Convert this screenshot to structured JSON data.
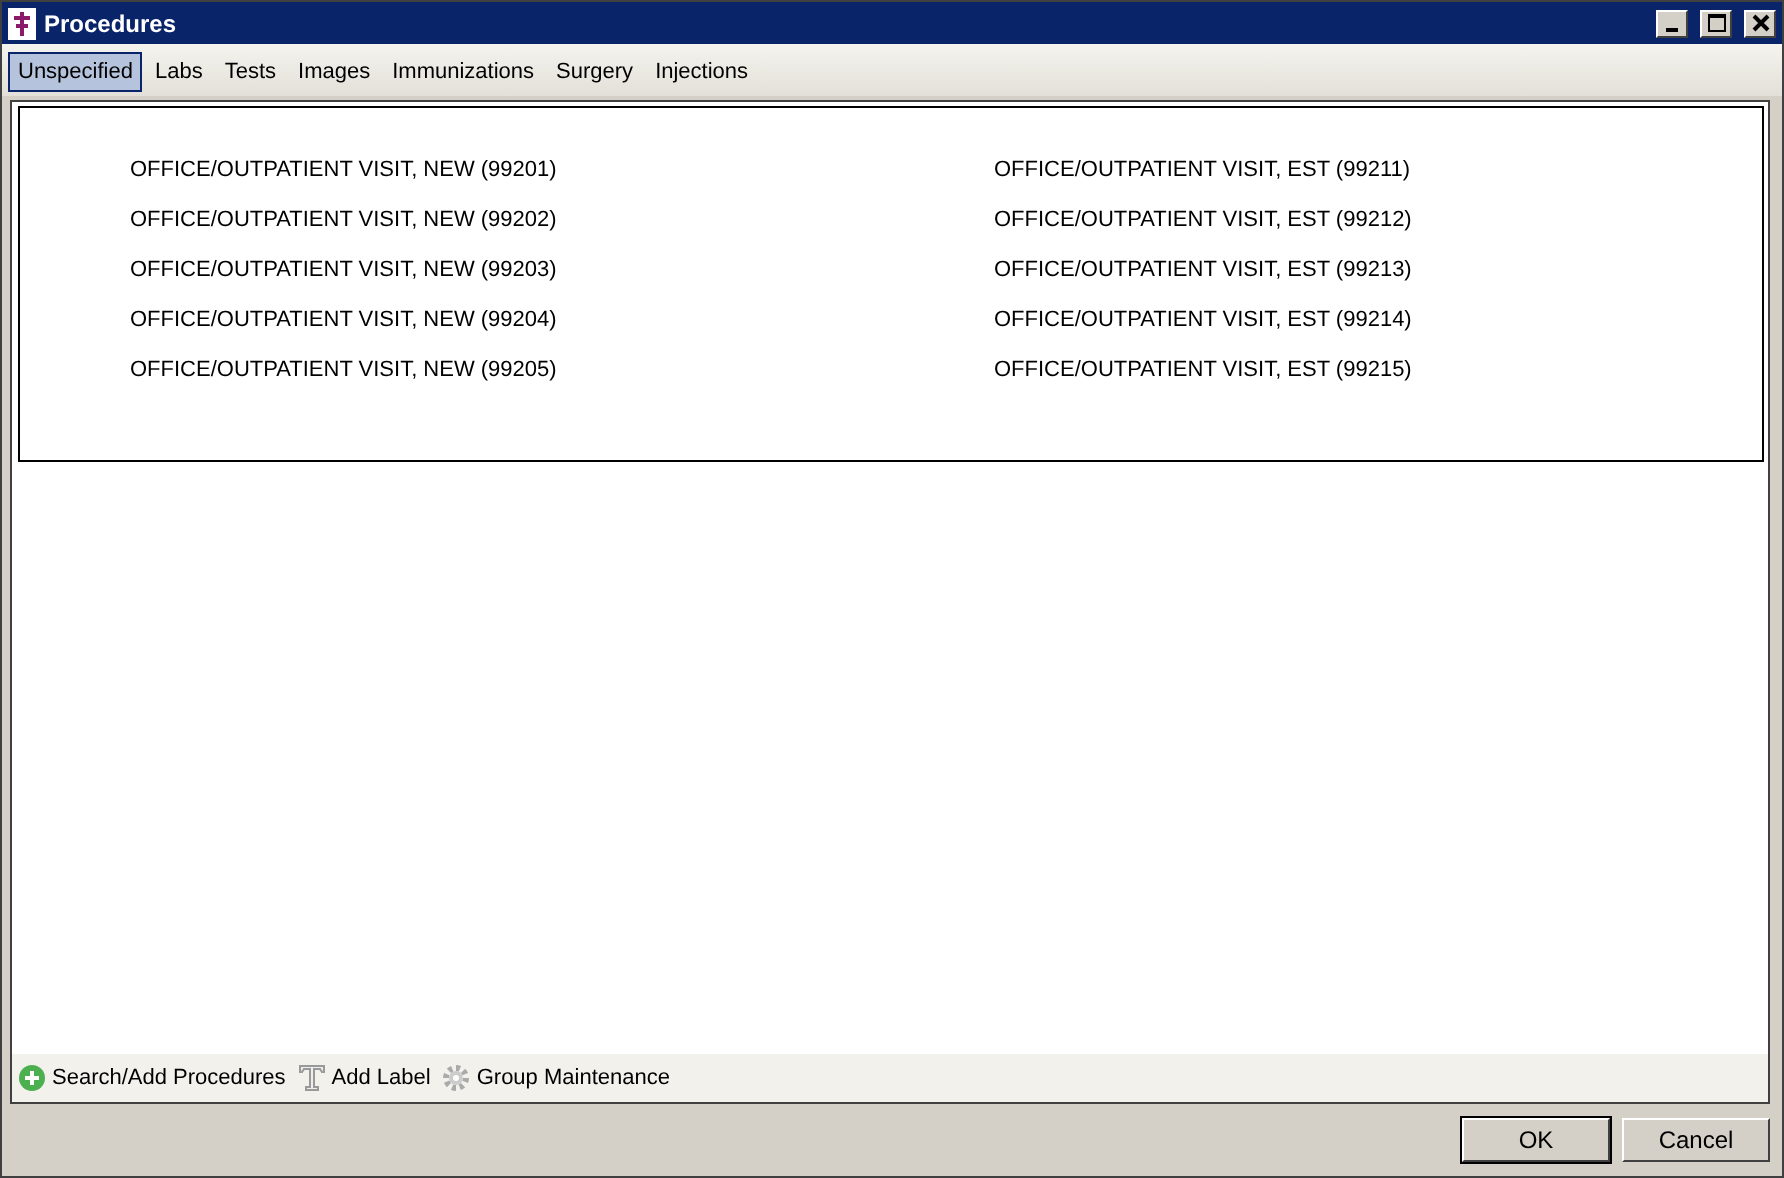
{
  "window": {
    "title": "Procedures"
  },
  "tabs": [
    {
      "label": "Unspecified",
      "selected": true
    },
    {
      "label": "Labs",
      "selected": false
    },
    {
      "label": "Tests",
      "selected": false
    },
    {
      "label": "Images",
      "selected": false
    },
    {
      "label": "Immunizations",
      "selected": false
    },
    {
      "label": "Surgery",
      "selected": false
    },
    {
      "label": "Injections",
      "selected": false
    }
  ],
  "procedures": [
    [
      "OFFICE/OUTPATIENT VISIT, NEW (99201)",
      "OFFICE/OUTPATIENT VISIT, NEW (99202)",
      "OFFICE/OUTPATIENT VISIT, NEW (99203)",
      "OFFICE/OUTPATIENT VISIT, NEW (99204)",
      "OFFICE/OUTPATIENT VISIT, NEW (99205)"
    ],
    [
      "OFFICE/OUTPATIENT VISIT, EST (99211)",
      "OFFICE/OUTPATIENT VISIT, EST (99212)",
      "OFFICE/OUTPATIENT VISIT, EST (99213)",
      "OFFICE/OUTPATIENT VISIT, EST (99214)",
      "OFFICE/OUTPATIENT VISIT, EST (99215)"
    ]
  ],
  "toolbar": [
    {
      "kind": "add",
      "label": "Search/Add Procedures"
    },
    {
      "kind": "label",
      "label": "Add Label"
    },
    {
      "kind": "gear",
      "label": "Group Maintenance"
    }
  ],
  "buttons": [
    "OK",
    "Cancel"
  ]
}
